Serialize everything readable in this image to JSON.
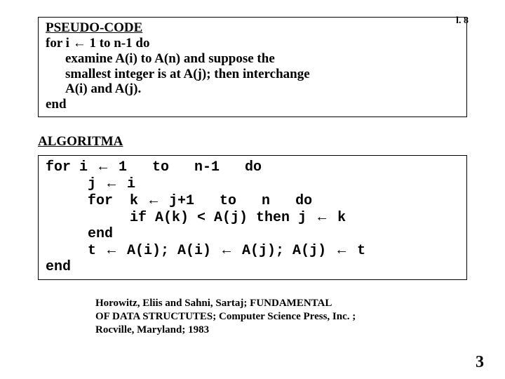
{
  "header": {
    "mark": "l. 8"
  },
  "pseudo": {
    "title": "PSEUDO-CODE",
    "line1_a": "for i ",
    "line1_b": " 1  to   n-1  do",
    "line2": "examine A(i) to A(n) and suppose the",
    "line3": "smallest integer is at A(j); then interchange",
    "line4": "A(i) and A(j).",
    "line5": "end"
  },
  "algoritma": {
    "title": "ALGORITMA",
    "l1a": "for i ",
    "l1b": " 1   to   n-1   do",
    "l2a": "     j ",
    "l2b": " i",
    "l3a": "     for  k ",
    "l3b": " j+1   to   n   do",
    "l4a": "          if A(k) < A(j) then j ",
    "l4b": " k",
    "l5": "     end",
    "l6a": "     t ",
    "l6b": " A(i); A(i) ",
    "l6c": " A(j); A(j) ",
    "l6d": " t",
    "l7": "end"
  },
  "citation": {
    "l1": "Horowitz, Eliis and Sahni, Sartaj; FUNDAMENTAL",
    "l2": "OF DATA STRUCTUTES; Computer Science Press, Inc. ;",
    "l3": "Rocville,  Maryland; 1983"
  },
  "page_number": "3",
  "arrow": "←"
}
